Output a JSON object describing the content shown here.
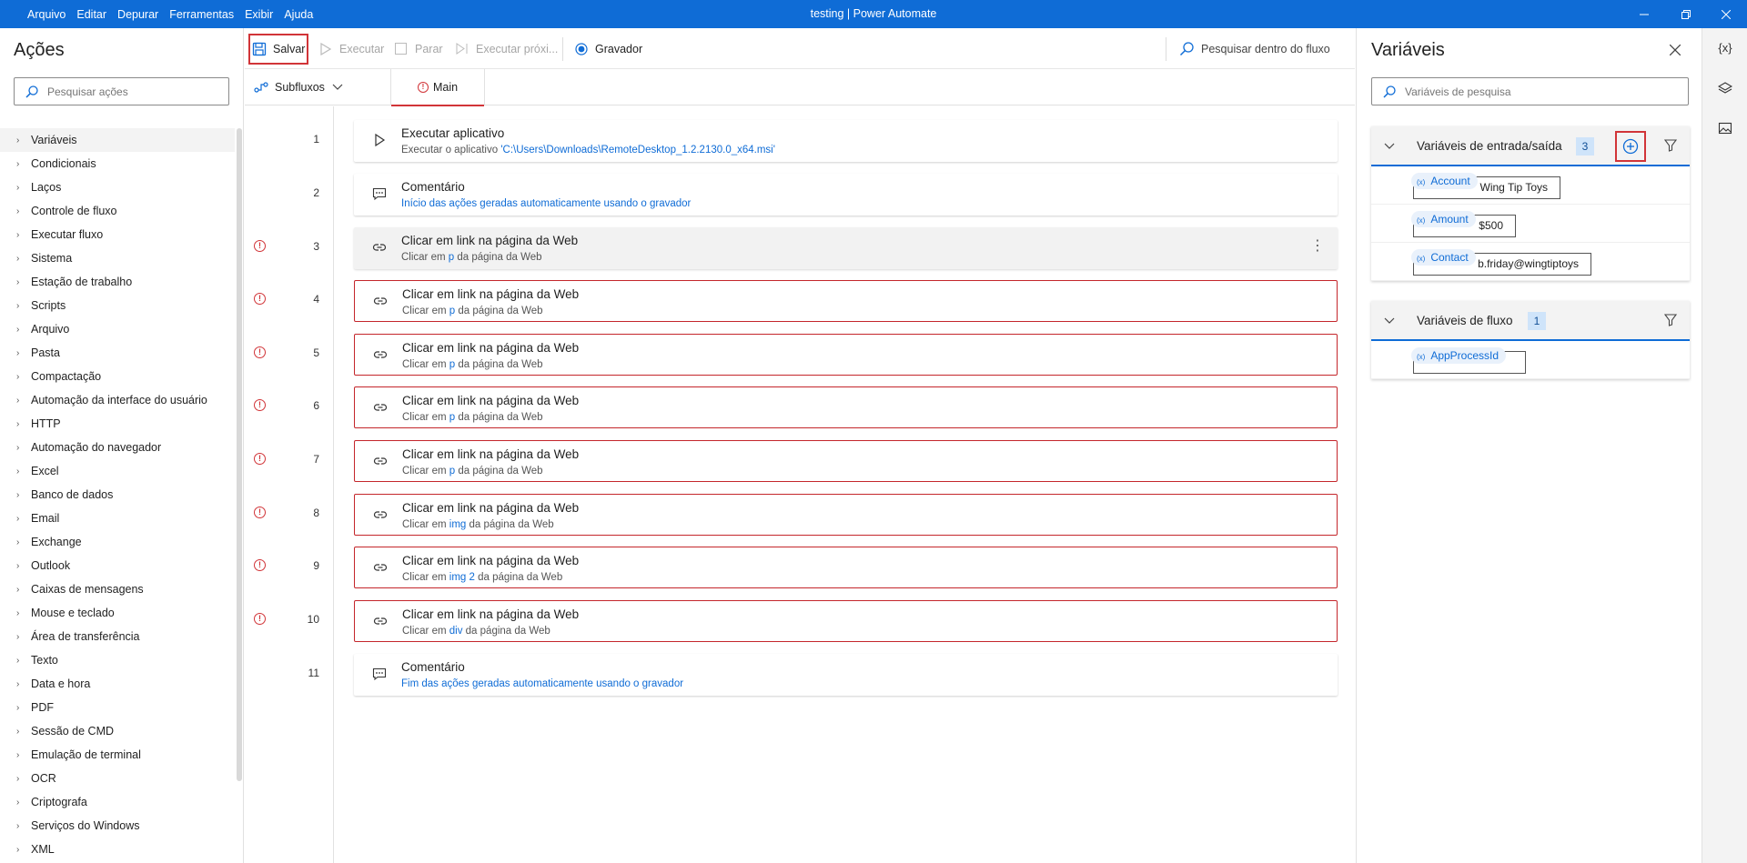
{
  "window": {
    "title": "testing | Power Automate"
  },
  "menu": [
    "Arquivo",
    "Editar",
    "Depurar",
    "Ferramentas",
    "Exibir",
    "Ajuda"
  ],
  "actions": {
    "title": "Ações",
    "search_placeholder": "Pesquisar ações",
    "categories": [
      "Variáveis",
      "Condicionais",
      "Laços",
      "Controle de fluxo",
      "Executar fluxo",
      "Sistema",
      "Estação de trabalho",
      "Scripts",
      "Arquivo",
      "Pasta",
      "Compactação",
      "Automação da interface do usuário",
      "HTTP",
      "Automação do navegador",
      "Excel",
      "Banco de dados",
      "Email",
      "Exchange",
      "Outlook",
      "Caixas de mensagens",
      "Mouse e teclado",
      "Área de transferência",
      "Texto",
      "Data e hora",
      "PDF",
      "Sessão de CMD",
      "Emulação de terminal",
      "OCR",
      "Criptografa",
      "Serviços do Windows",
      "XML"
    ]
  },
  "toolbar": {
    "save": "Salvar",
    "run": "Executar",
    "stop": "Parar",
    "run_next": "Executar próxi...",
    "recorder": "Gravador",
    "search_flow": "Pesquisar dentro do fluxo"
  },
  "tabs": {
    "subflows": "Subfluxos",
    "main": "Main"
  },
  "steps": [
    {
      "num": "1",
      "title": "Executar aplicativo",
      "pre": "Executar o aplicativo ",
      "link": "'C:\\Users\\Downloads\\RemoteDesktop_1.2.2130.0_x64.msi'",
      "post": "",
      "icon": "play-icon",
      "warn": false,
      "style": "normal"
    },
    {
      "num": "2",
      "title": "Comentário",
      "pre": "",
      "link": "Início das ações geradas automaticamente usando o gravador",
      "post": "",
      "icon": "comment-icon",
      "warn": false,
      "style": "normal"
    },
    {
      "num": "3",
      "title": "Clicar em link na página da Web",
      "pre": "Clicar em ",
      "link": "p",
      "post": " da página da Web",
      "icon": "link-icon",
      "warn": true,
      "style": "highlight"
    },
    {
      "num": "4",
      "title": "Clicar em link na página da Web",
      "pre": "Clicar em ",
      "link": "p",
      "post": " da página da Web",
      "icon": "link-icon",
      "warn": true,
      "style": "error"
    },
    {
      "num": "5",
      "title": "Clicar em link na página da Web",
      "pre": "Clicar em ",
      "link": "p",
      "post": " da página da Web",
      "icon": "link-icon",
      "warn": true,
      "style": "error"
    },
    {
      "num": "6",
      "title": "Clicar em link na página da Web",
      "pre": "Clicar em ",
      "link": "p",
      "post": " da página da Web",
      "icon": "link-icon",
      "warn": true,
      "style": "error"
    },
    {
      "num": "7",
      "title": "Clicar em link na página da Web",
      "pre": "Clicar em ",
      "link": "p",
      "post": " da página da Web",
      "icon": "link-icon",
      "warn": true,
      "style": "error"
    },
    {
      "num": "8",
      "title": "Clicar em link na página da Web",
      "pre": "Clicar em ",
      "link": "img",
      "post": " da página da Web",
      "icon": "link-icon",
      "warn": true,
      "style": "error"
    },
    {
      "num": "9",
      "title": "Clicar em link na página da Web",
      "pre": "Clicar em ",
      "link": "img 2",
      "post": " da página da Web",
      "icon": "link-icon",
      "warn": true,
      "style": "error"
    },
    {
      "num": "10",
      "title": "Clicar em link na página da Web",
      "pre": "Clicar em ",
      "link": "div",
      "post": " da página da Web",
      "icon": "link-icon",
      "warn": true,
      "style": "error"
    },
    {
      "num": "11",
      "title": "Comentário",
      "pre": "",
      "link": "Fim das ações geradas automaticamente usando o gravador",
      "post": "",
      "icon": "comment-icon",
      "warn": false,
      "style": "normal"
    }
  ],
  "variables": {
    "title": "Variáveis",
    "search_placeholder": "Variáveis de pesquisa",
    "io": {
      "label": "Variáveis de entrada/saída",
      "count": "3",
      "items": [
        {
          "name": "Account",
          "value": "Wing Tip Toys"
        },
        {
          "name": "Amount",
          "value": "$500"
        },
        {
          "name": "Contact",
          "value": "b.friday@wingtiptoys"
        }
      ]
    },
    "flow": {
      "label": "Variáveis de fluxo",
      "count": "1",
      "items": [
        {
          "name": "AppProcessId",
          "value": ""
        }
      ]
    }
  },
  "rail": {
    "vars_label": "{x}"
  },
  "colors": {
    "accent": "#0f6cd6",
    "error": "#d13438"
  }
}
